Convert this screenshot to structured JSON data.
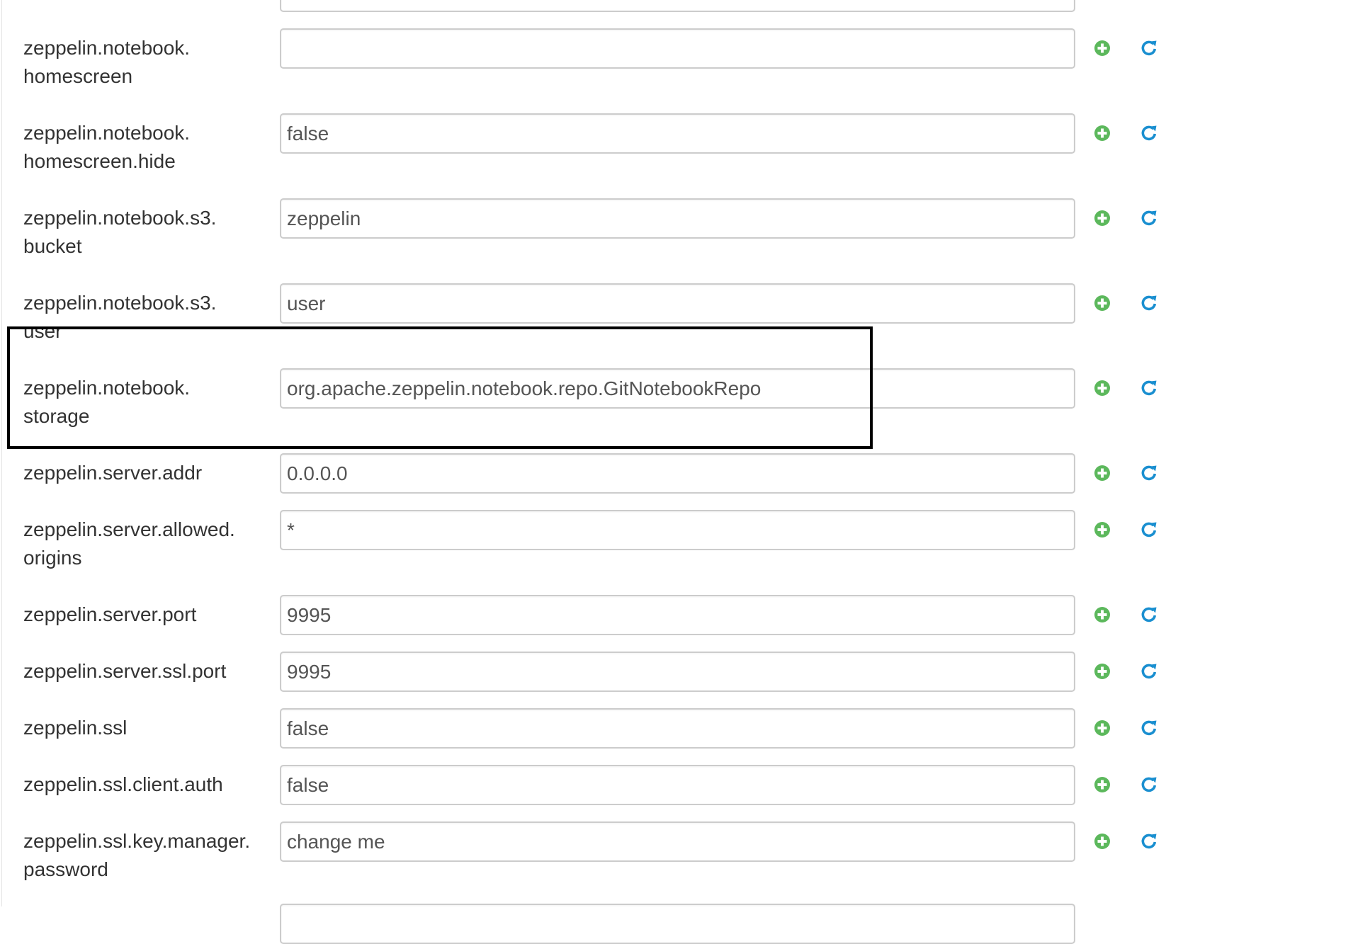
{
  "properties": [
    {
      "name_lines": [
        "zeppelin.notebook.",
        "homescreen"
      ],
      "value": "",
      "add_icon": "plus-circle-icon",
      "reset_icon": "refresh-icon"
    },
    {
      "name_lines": [
        "zeppelin.notebook.",
        "homescreen.hide"
      ],
      "value": "false",
      "add_icon": "plus-circle-icon",
      "reset_icon": "refresh-icon"
    },
    {
      "name_lines": [
        "zeppelin.notebook.s3.",
        "bucket"
      ],
      "value": "zeppelin",
      "add_icon": "plus-circle-icon",
      "reset_icon": "refresh-icon"
    },
    {
      "name_lines": [
        "zeppelin.notebook.s3.",
        "user"
      ],
      "value": "user",
      "add_icon": "plus-circle-icon",
      "reset_icon": "refresh-icon"
    },
    {
      "name_lines": [
        "zeppelin.notebook.",
        "storage"
      ],
      "value": "org.apache.zeppelin.notebook.repo.GitNotebookRepo",
      "add_icon": "plus-circle-icon",
      "reset_icon": "refresh-icon"
    },
    {
      "name_lines": [
        "zeppelin.server.addr"
      ],
      "value": "0.0.0.0",
      "add_icon": "plus-circle-icon",
      "reset_icon": "refresh-icon"
    },
    {
      "name_lines": [
        "zeppelin.server.allowed.",
        "origins"
      ],
      "value": "*",
      "add_icon": "plus-circle-icon",
      "reset_icon": "refresh-icon"
    },
    {
      "name_lines": [
        "zeppelin.server.port"
      ],
      "value": "9995",
      "add_icon": "plus-circle-icon",
      "reset_icon": "refresh-icon"
    },
    {
      "name_lines": [
        "zeppelin.server.ssl.port"
      ],
      "value": "9995",
      "add_icon": "plus-circle-icon",
      "reset_icon": "refresh-icon"
    },
    {
      "name_lines": [
        "zeppelin.ssl"
      ],
      "value": "false",
      "add_icon": "plus-circle-icon",
      "reset_icon": "refresh-icon"
    },
    {
      "name_lines": [
        "zeppelin.ssl.client.auth"
      ],
      "value": "false",
      "add_icon": "plus-circle-icon",
      "reset_icon": "refresh-icon"
    },
    {
      "name_lines": [
        "zeppelin.ssl.key.manager.",
        "password"
      ],
      "value": "change me",
      "add_icon": "plus-circle-icon",
      "reset_icon": "refresh-icon"
    }
  ],
  "colors": {
    "add_icon": "#5cb85c",
    "reset_icon": "#1a8fd0",
    "highlight_border": "#000000"
  }
}
